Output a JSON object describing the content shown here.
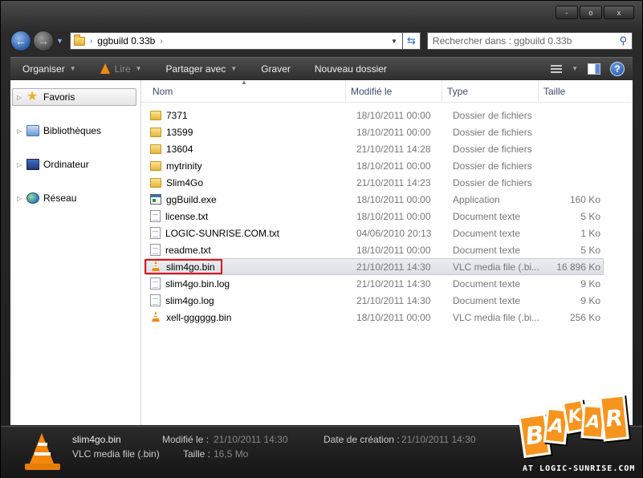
{
  "window": {
    "caption_buttons": [
      "-",
      "o",
      "x"
    ]
  },
  "address": {
    "path": "ggbuild 0.33b",
    "search_placeholder": "Rechercher dans : ggbuild 0.33b"
  },
  "toolbar": {
    "organize": "Organiser",
    "play": "Lire",
    "share": "Partager avec",
    "burn": "Graver",
    "new_folder": "Nouveau dossier",
    "help": "?"
  },
  "nav": {
    "items": [
      {
        "label": "Favoris",
        "icon": "star-icon"
      },
      {
        "label": "Bibliothèques",
        "icon": "libraries-icon"
      },
      {
        "label": "Ordinateur",
        "icon": "computer-icon"
      },
      {
        "label": "Réseau",
        "icon": "network-icon"
      }
    ]
  },
  "columns": {
    "name": "Nom",
    "date": "Modifié le",
    "type": "Type",
    "size": "Taille"
  },
  "files": [
    {
      "name": "7371",
      "date": "18/10/2011 00:00",
      "type": "Dossier de fichiers",
      "size": "",
      "icon": "folder"
    },
    {
      "name": "13599",
      "date": "18/10/2011 00:00",
      "type": "Dossier de fichiers",
      "size": "",
      "icon": "folder"
    },
    {
      "name": "13604",
      "date": "21/10/2011 14:28",
      "type": "Dossier de fichiers",
      "size": "",
      "icon": "folder"
    },
    {
      "name": "mytrinity",
      "date": "18/10/2011 00:00",
      "type": "Dossier de fichiers",
      "size": "",
      "icon": "folder"
    },
    {
      "name": "Slim4Go",
      "date": "21/10/2011 14:23",
      "type": "Dossier de fichiers",
      "size": "",
      "icon": "folder"
    },
    {
      "name": "ggBuild.exe",
      "date": "18/10/2011 00:00",
      "type": "Application",
      "size": "160 Ko",
      "icon": "exe"
    },
    {
      "name": "license.txt",
      "date": "18/10/2011 00:00",
      "type": "Document texte",
      "size": "5 Ko",
      "icon": "doc"
    },
    {
      "name": "LOGIC-SUNRISE.COM.txt",
      "date": "04/06/2010 20:13",
      "type": "Document texte",
      "size": "1 Ko",
      "icon": "doc"
    },
    {
      "name": "readme.txt",
      "date": "18/10/2011 00:00",
      "type": "Document texte",
      "size": "5 Ko",
      "icon": "doc"
    },
    {
      "name": "slim4go.bin",
      "date": "21/10/2011 14:30",
      "type": "VLC media file (.bi...",
      "size": "16 896 Ko",
      "icon": "vlc",
      "selected": true
    },
    {
      "name": "slim4go.bin.log",
      "date": "21/10/2011 14:30",
      "type": "Document texte",
      "size": "9 Ko",
      "icon": "doc"
    },
    {
      "name": "slim4go.log",
      "date": "21/10/2011 14:30",
      "type": "Document texte",
      "size": "9 Ko",
      "icon": "doc"
    },
    {
      "name": "xell-gggggg.bin",
      "date": "18/10/2011 00:00",
      "type": "VLC media file (.bi...",
      "size": "256 Ko",
      "icon": "vlc"
    }
  ],
  "details": {
    "name": "slim4go.bin",
    "type": "VLC media file (.bin)",
    "modified_label": "Modifié le :",
    "modified_value": "21/10/2011 14:30",
    "size_label": "Taille :",
    "size_value": "16,5 Mo",
    "created_label": "Date de création :",
    "created_value": "21/10/2011 14:30"
  },
  "logo": {
    "letters": [
      "B",
      "A",
      "K",
      "A",
      "R"
    ],
    "watermark": "AT LOGIC-SUNRISE.COM"
  },
  "colors": {
    "highlight": "#e0141e",
    "vlc_orange": "#f5870a",
    "logo_orange": "#f7941d"
  }
}
